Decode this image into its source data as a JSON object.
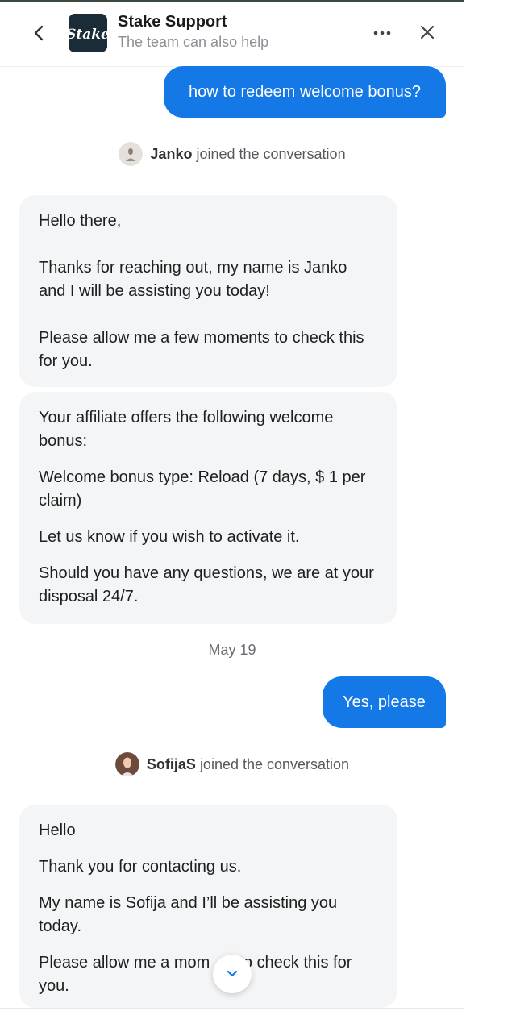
{
  "header": {
    "back_icon": "chevron-left-icon",
    "logo_text": "Stake",
    "title": "Stake Support",
    "subtitle": "The team can also help",
    "more_icon": "more-horizontal-icon",
    "close_icon": "close-icon"
  },
  "colors": {
    "accent": "#1479e6",
    "incoming_bubble": "#f4f5f6",
    "logo_bg": "#1a2c38"
  },
  "messages": {
    "m1": {
      "text": "how to redeem welcome bonus?"
    },
    "join1": {
      "name": "Janko",
      "text": "joined the conversation"
    },
    "m2": {
      "lines": [
        "Hello there,",
        "Thanks for reaching out, my name is Janko and I will be assisting you today!",
        "Please allow me a few moments to check this for you."
      ]
    },
    "m3": {
      "lines": [
        "Your affiliate offers the following welcome bonus:",
        "Welcome bonus type: Reload (7 days, $ 1 per claim)",
        "Let us know if you wish to activate it.",
        "Should you have any questions, we are at your disposal 24/7."
      ]
    },
    "date": "May 19",
    "m4": {
      "text": "Yes, please"
    },
    "join2": {
      "name": "SofijaS",
      "text": "joined the conversation"
    },
    "m5": {
      "lines": [
        "Hello",
        "Thank you for contacting us.",
        "My name is Sofija and I’ll be assisting you today.",
        "Please allow me a mom",
        "to check this for",
        "you."
      ]
    }
  },
  "scroll_icon": "chevron-down-icon"
}
